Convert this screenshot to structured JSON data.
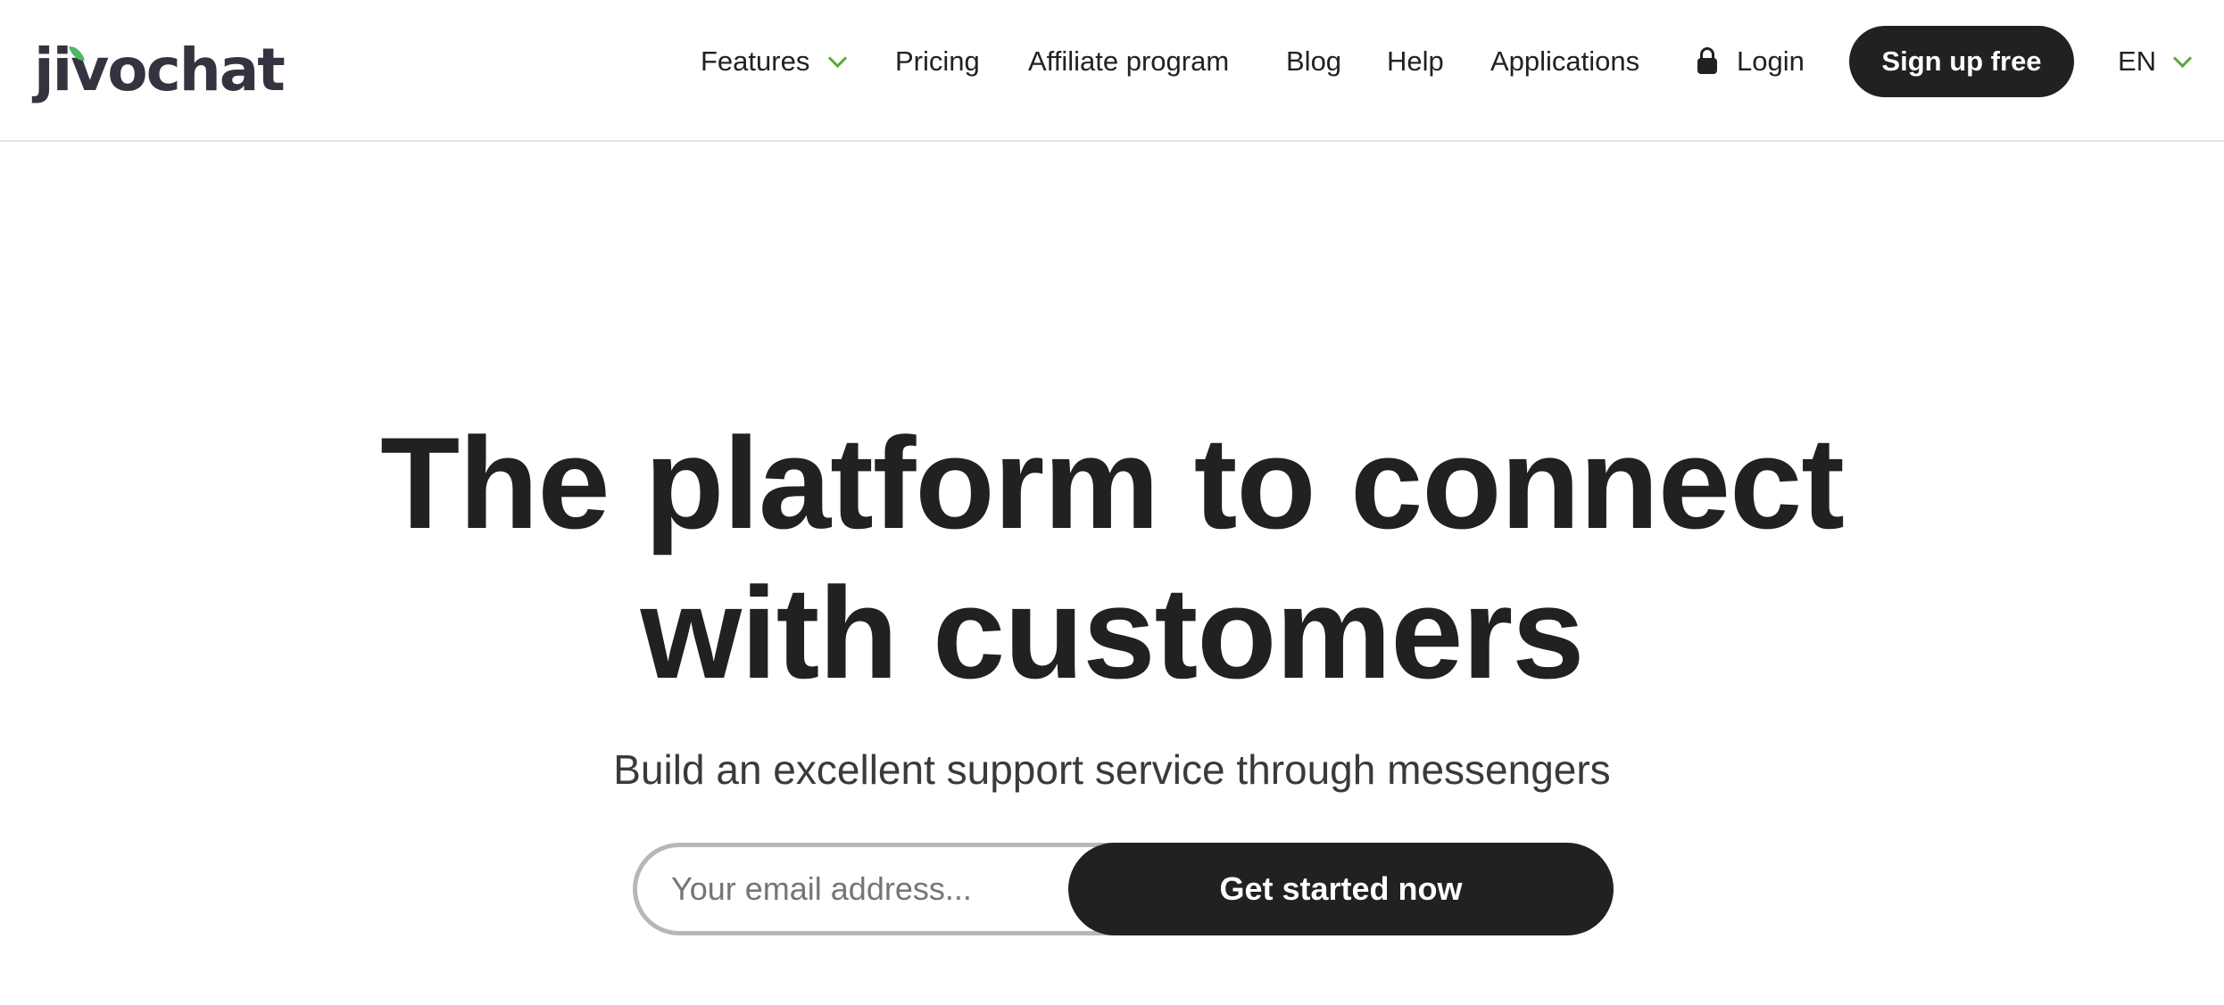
{
  "header": {
    "logo": {
      "text": "jivochat",
      "leaf_color": "#4cb963"
    },
    "nav": [
      {
        "label": "Features",
        "has_dropdown": true
      },
      {
        "label": "Pricing"
      },
      {
        "label": "Affiliate program"
      },
      {
        "label": "Blog"
      },
      {
        "label": "Help"
      },
      {
        "label": "Applications"
      }
    ],
    "login": {
      "label": "Login",
      "icon": "lock-icon"
    },
    "signup_label": "Sign up free",
    "language": {
      "selected": "EN",
      "has_dropdown": true
    },
    "accent_color": "#5aaa3c"
  },
  "hero": {
    "title_line1": "The platform to connect",
    "title_line2": "with customers",
    "subtitle": "Build an excellent support service through messengers",
    "email_placeholder": "Your email address...",
    "email_value": "",
    "cta_label": "Get started now"
  },
  "colors": {
    "primary_dark": "#212121",
    "input_border": "#b5b7bb"
  }
}
